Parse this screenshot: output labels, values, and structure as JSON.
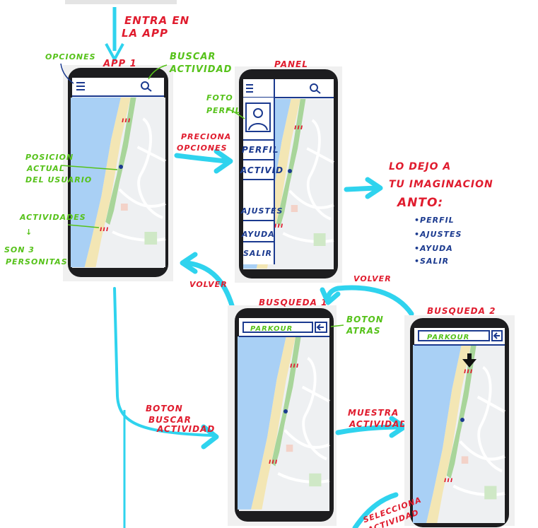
{
  "labels": {
    "entra": "ENTRA EN LA APP",
    "app1": "APP 1",
    "opciones": "OPCIONES",
    "buscar": "BUSCAR ACTIVIDAD",
    "posicion": "POSICION ACTUAL DEL USUARIO",
    "actividades": "ACTIVIDADES",
    "son3": "SON 3 PERSONITAS",
    "preciona": "PRECIONA OPCIONES",
    "panel": "PANEL",
    "foto": "FOTO PERFIL",
    "dejo": "LO DEJO A TU IMAGINACION",
    "anto": "ANTO:",
    "volver1": "VOLVER",
    "volver2": "VOLVER",
    "busqueda1": "BUSQUEDA 1",
    "busqueda2": "BUSQUEDA 2",
    "boton_atras": "BOTON ATRAS",
    "boton_buscar": "BOTON BUSCAR ACTIVIDAD",
    "muestra": "MUESTRA ACTIVIDAD",
    "selecciona": "SELECCIONA ACTIVIDAD"
  },
  "menu_items": [
    "PERFIL",
    "ACTIVID",
    "AJUSTES",
    "AYUDA",
    "SALIR"
  ],
  "anto_list": [
    "•PERFIL",
    "•AJUSTES",
    "•AYUDA",
    "•SALIR"
  ],
  "search_value": "PARKOUR",
  "colors": {
    "annotation_red": "#e01c2e",
    "annotation_green": "#56c21a",
    "arrow": "#2fd3ee",
    "sketch_blue": "#1b3a8f"
  }
}
